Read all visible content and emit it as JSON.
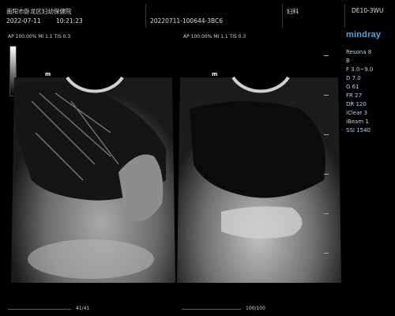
{
  "header": {
    "institution": "南阳市卧龙区妇幼保健院",
    "date": "2022-07-11",
    "time": "10:21:23",
    "exam_id": "20220711-100644-3BC6",
    "department": "妇科",
    "probe": "DE10-3WU"
  },
  "brand": {
    "logo": "mindray"
  },
  "image_info": {
    "left": "AP 100.00%  MI 1.1  TIS 0.3",
    "right": "AP 100.00%  MI 1.1  TIS 0.3"
  },
  "params": {
    "model": "Resona 8",
    "mode": "B",
    "freq": "F 3.0~9.0",
    "depth": "D 7.0",
    "gain": "G 61",
    "frame_rate": "FR 27",
    "dynamic_range": "DR 120",
    "iclear": "iClear 3",
    "ibeam": "iBeam 1",
    "ssi": "SSI 1540"
  },
  "cine": {
    "left": "41/41",
    "right": "100/100"
  },
  "markers": {
    "left": "m",
    "right": "m"
  }
}
